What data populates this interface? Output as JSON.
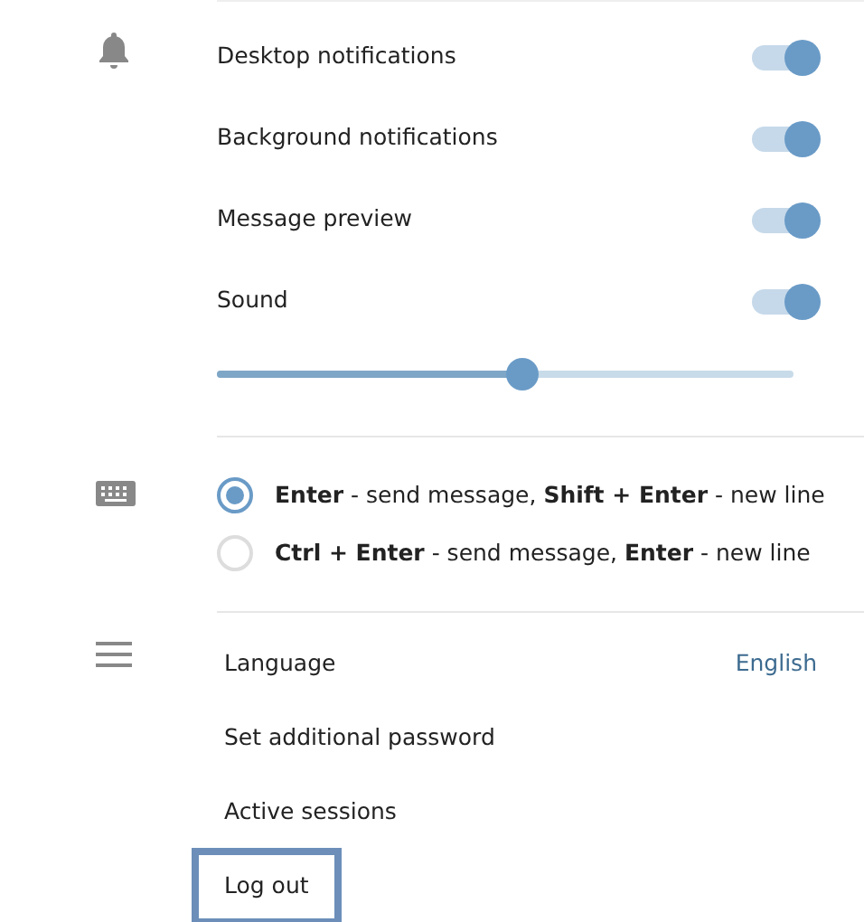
{
  "notifications": {
    "toggles": [
      {
        "label": "Desktop notifications",
        "on": true
      },
      {
        "label": "Background notifications",
        "on": true
      },
      {
        "label": "Message preview",
        "on": true
      },
      {
        "label": "Sound",
        "on": true
      }
    ],
    "volume": {
      "level": 0.53
    }
  },
  "send_mode": {
    "options": [
      {
        "text": "**Enter** - send message, **Shift + Enter** - new line",
        "selected": true
      },
      {
        "text": "**Ctrl + Enter** - send message, **Enter** - new line",
        "selected": false
      }
    ]
  },
  "general": {
    "items": [
      {
        "label": "Language",
        "value": "English",
        "highlighted": false
      },
      {
        "label": "Set additional password",
        "highlighted": false
      },
      {
        "label": "Active sessions",
        "highlighted": false
      },
      {
        "label": "Log out",
        "highlighted": true
      }
    ]
  }
}
